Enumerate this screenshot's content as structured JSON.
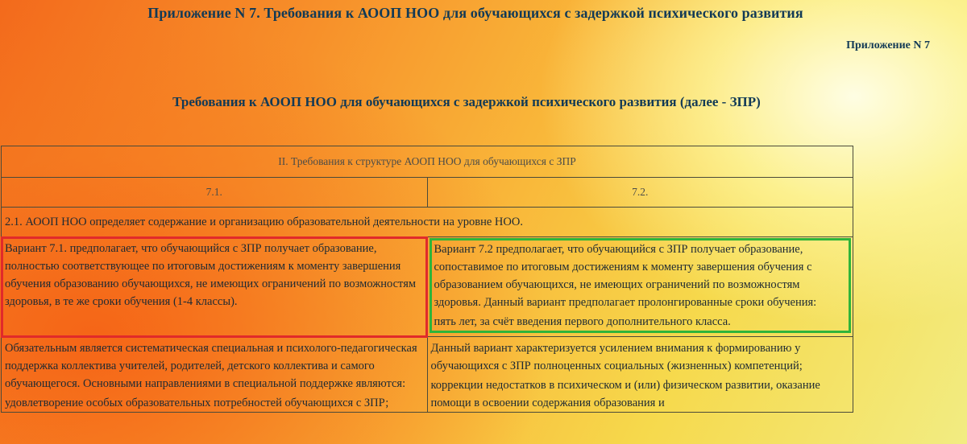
{
  "document": {
    "top_title": "Приложение N 7. Требования к АООП НОО для обучающихся с задержкой психического развития",
    "appendix_label": "Приложение N 7",
    "sub_title": "Требования к АООП НОО для обучающихся с задержкой психического развития (далее - ЗПР)"
  },
  "table": {
    "header": "II. Требования к структуре АООП НОО для обучающихся с ЗПР",
    "col_a": "7.1.",
    "col_b": "7.2.",
    "section": "2.1. АООП НОО определяет содержание и организацию образовательной деятельности на уровне НОО.",
    "row1": {
      "a": "Вариант 7.1. предполагает, что обучающийся с ЗПР получает образование, полностью соответствующее по итоговым достижениям к моменту завершения обучения образованию обучающихся, не имеющих ограничений по возможностям здоровья, в те же сроки обучения (1-4 классы).",
      "b1": "Вариант 7.2 предполагает, что обучающийся с ЗПР получает образование, сопоставимое по итоговым достижениям к моменту завершения обучения с образованием обучающихся, не имеющих ограничений по возможностям здоровья. Данный вариант предполагает пролонгированные сроки обучения:",
      "b2": "пять лет, за счёт введения первого дополнительного класса."
    },
    "row2": {
      "a1": "Обязательным является систематическая специальная и психолого-педагогическая поддержка коллектива учителей, родителей, детского коллектива и самого обучающегося. Основными направлениями в специальной поддержке являются:",
      "a2": "удовлетворение особых образовательных потребностей обучающихся с ЗПР;",
      "b1": "Данный вариант характеризуется усилением внимания к формированию у обучающихся с ЗПР полноценных социальных (жизненных) компетенций;",
      "b2": "коррекции недостатков в психическом и (или) физическом развитии, оказание помощи в освоении содержания образования и"
    }
  },
  "colors": {
    "heading": "#123a56",
    "highlight_red": "#e12a2a",
    "highlight_green": "#2fb43a"
  }
}
